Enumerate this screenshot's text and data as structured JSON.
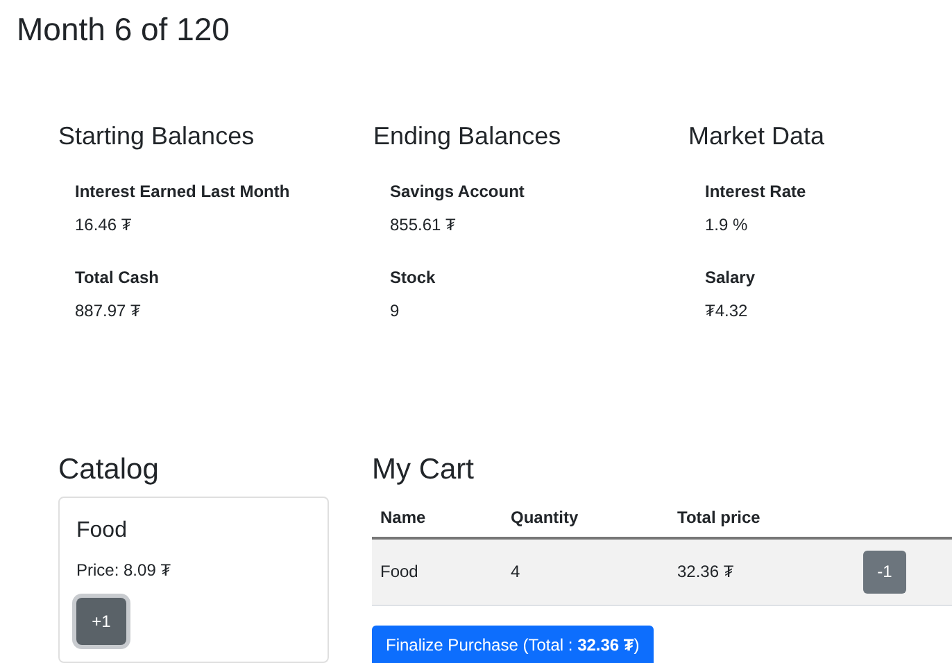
{
  "title": "Month 6 of 120",
  "sections": [
    {
      "heading": "Starting Balances",
      "items": [
        {
          "label": "Interest Earned Last Month",
          "value": "16.46 ₮"
        },
        {
          "label": "Total Cash",
          "value": "887.97 ₮"
        }
      ]
    },
    {
      "heading": "Ending Balances",
      "items": [
        {
          "label": "Savings Account",
          "value": "855.61 ₮"
        },
        {
          "label": "Stock",
          "value": "9"
        }
      ]
    },
    {
      "heading": "Market Data",
      "items": [
        {
          "label": "Interest Rate",
          "value": "1.9 %"
        },
        {
          "label": "Salary",
          "value": "₮4.32"
        }
      ]
    }
  ],
  "catalog": {
    "heading": "Catalog",
    "items": [
      {
        "name": "Food",
        "price": "Price: 8.09 ₮",
        "button": "+1"
      }
    ]
  },
  "cart": {
    "heading": "My Cart",
    "columns": [
      "Name",
      "Quantity",
      "Total price"
    ],
    "rows": [
      {
        "cells": [
          "Food",
          "4",
          "32.36 ₮"
        ],
        "button": "-1"
      }
    ],
    "finalize": "Finalize Purchase (Total : **32.36 ₮**)"
  }
}
